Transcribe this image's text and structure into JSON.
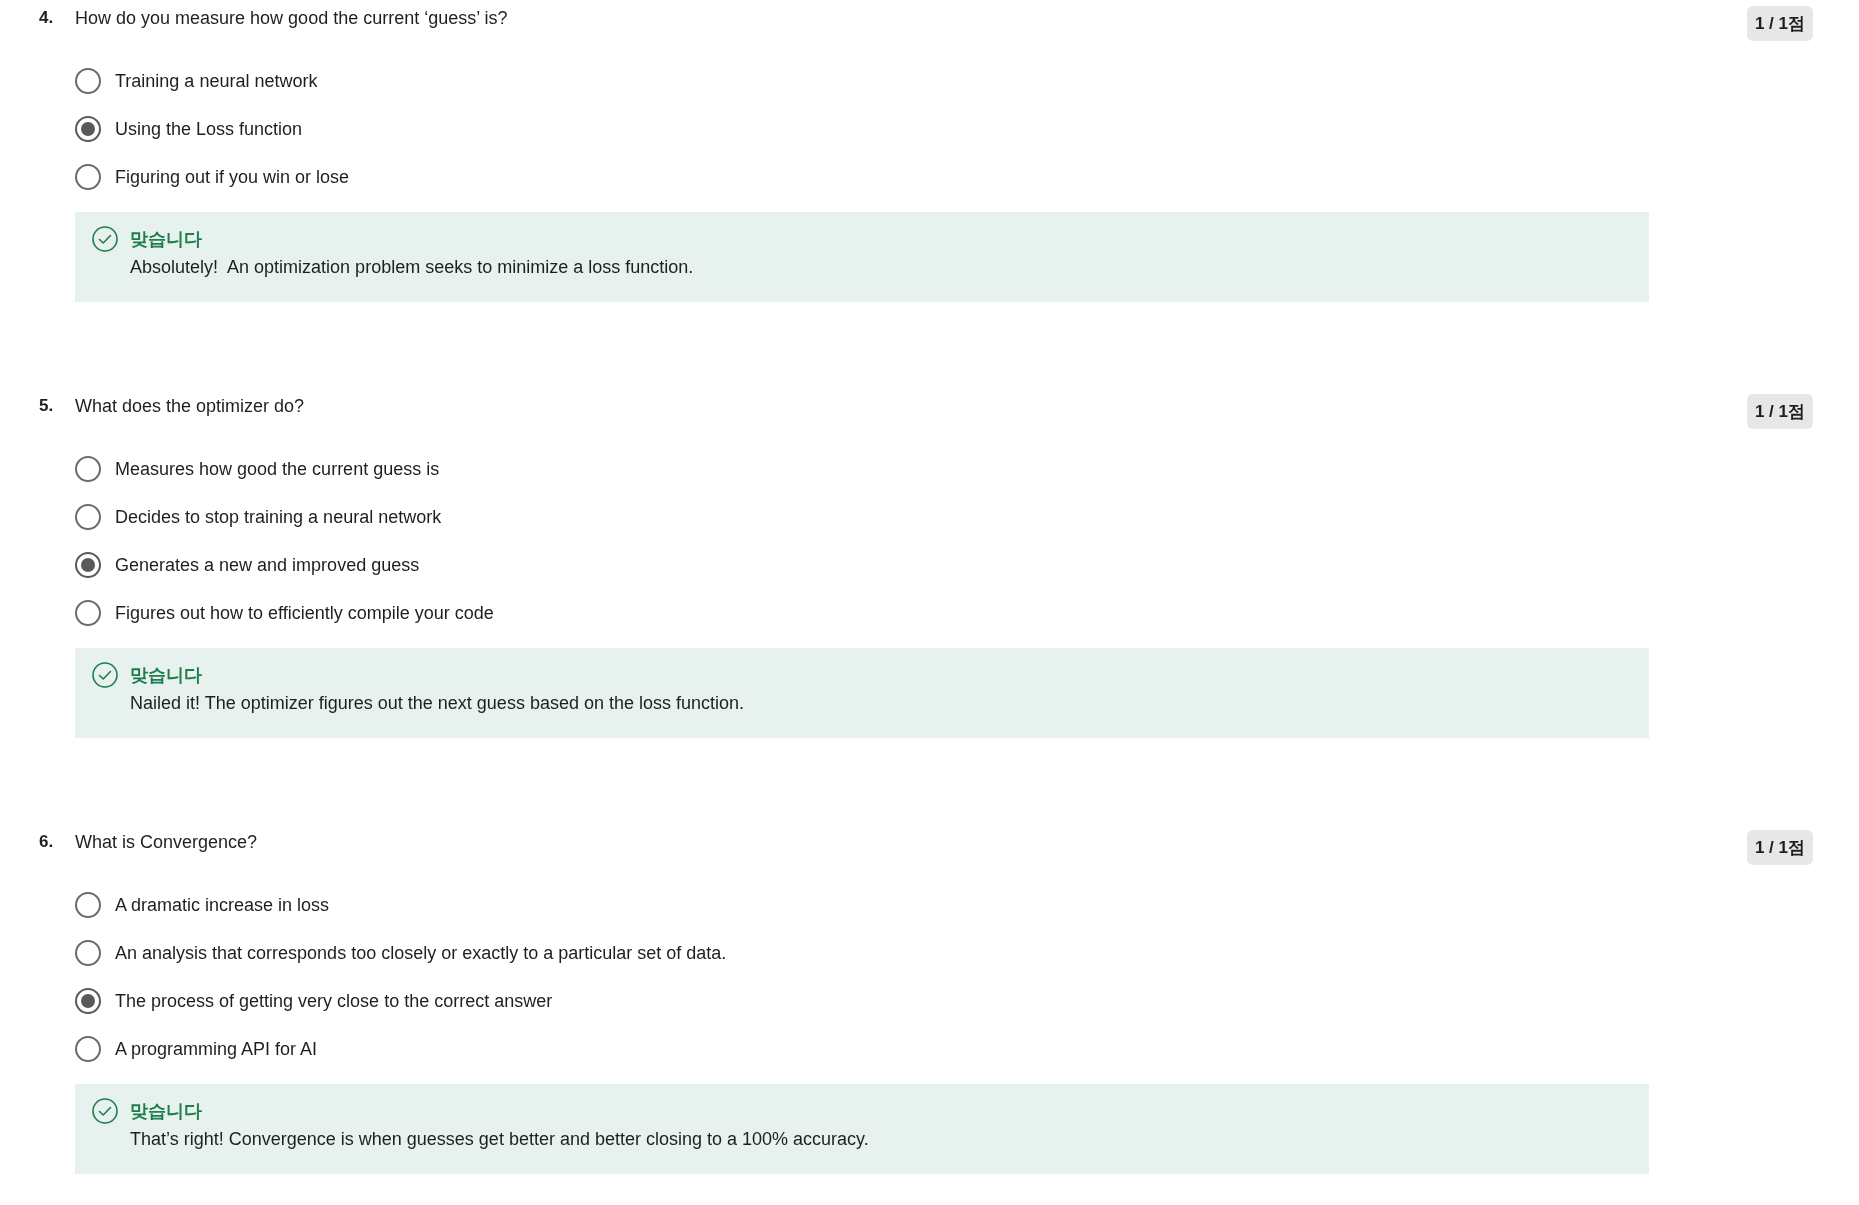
{
  "questions": [
    {
      "number": "4.",
      "text": "How do you measure how good the current ‘guess’ is?",
      "score": "1 / 1점",
      "options": [
        {
          "label": "Training a neural network",
          "selected": false
        },
        {
          "label": "Using the Loss function",
          "selected": true
        },
        {
          "label": "Figuring out if you win or lose",
          "selected": false
        }
      ],
      "feedback": {
        "kind": "correct",
        "title": "맞습니다",
        "message": "Absolutely!  An optimization problem seeks to minimize a loss function."
      }
    },
    {
      "number": "5.",
      "text": "What does the optimizer do?",
      "score": "1 / 1점",
      "options": [
        {
          "label": "Measures how good the current guess is",
          "selected": false
        },
        {
          "label": "Decides to stop training a neural network",
          "selected": false
        },
        {
          "label": "Generates a new and improved guess",
          "selected": true
        },
        {
          "label": "Figures out how to efficiently compile your code",
          "selected": false
        }
      ],
      "feedback": {
        "kind": "correct",
        "title": "맞습니다",
        "message": "Nailed it! The optimizer figures out the next guess based on the loss function."
      }
    },
    {
      "number": "6.",
      "text": "What is Convergence?",
      "score": "1 / 1점",
      "options": [
        {
          "label": "A dramatic increase in loss",
          "selected": false
        },
        {
          "label": "An analysis that corresponds too closely or exactly to a particular set of data.",
          "selected": false
        },
        {
          "label": "The process of getting very close to the correct answer",
          "selected": true
        },
        {
          "label": "A programming API for AI",
          "selected": false
        }
      ],
      "feedback": {
        "kind": "correct",
        "title": "맞습니다",
        "message": "That’s right! Convergence is when guesses get better and better closing to a 100% accuracy."
      }
    }
  ]
}
